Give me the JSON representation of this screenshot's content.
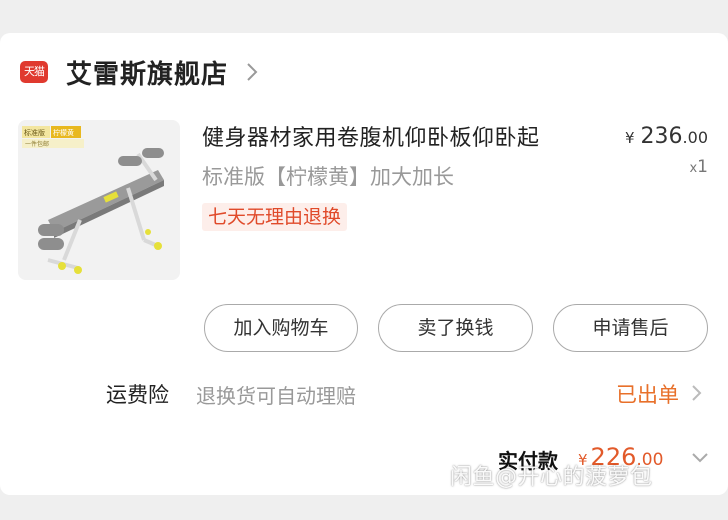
{
  "shop": {
    "platform_badge": "天猫",
    "name": "艾雷斯旗舰店"
  },
  "product": {
    "image_badge_1": "标准版",
    "image_badge_2": "柠檬黄",
    "image_caption": "一件包邮",
    "title": "健身器材家用卷腹机仰卧板仰卧起",
    "sku": "标准版【柠檬黄】加大加长",
    "tag": "七天无理由退换",
    "price_symbol": "¥",
    "price_int": "236",
    "price_dec": ".00",
    "qty_prefix": "x",
    "qty": "1"
  },
  "actions": {
    "add_cart": "加入购物车",
    "resell": "卖了换钱",
    "after_sale": "申请售后"
  },
  "insurance": {
    "label": "运费险",
    "desc": "退换货可自动理赔",
    "status": "已出单"
  },
  "payment": {
    "label": "实付款",
    "symbol": "¥",
    "int": "226",
    "dec": ".00"
  },
  "watermark": "闲鱼@开心的菠萝包",
  "colors": {
    "accent_orange": "#e8702a",
    "tag_red": "#e04a2a",
    "tmall_red": "#e03a2f",
    "product_yellow": "#e6e03a"
  }
}
